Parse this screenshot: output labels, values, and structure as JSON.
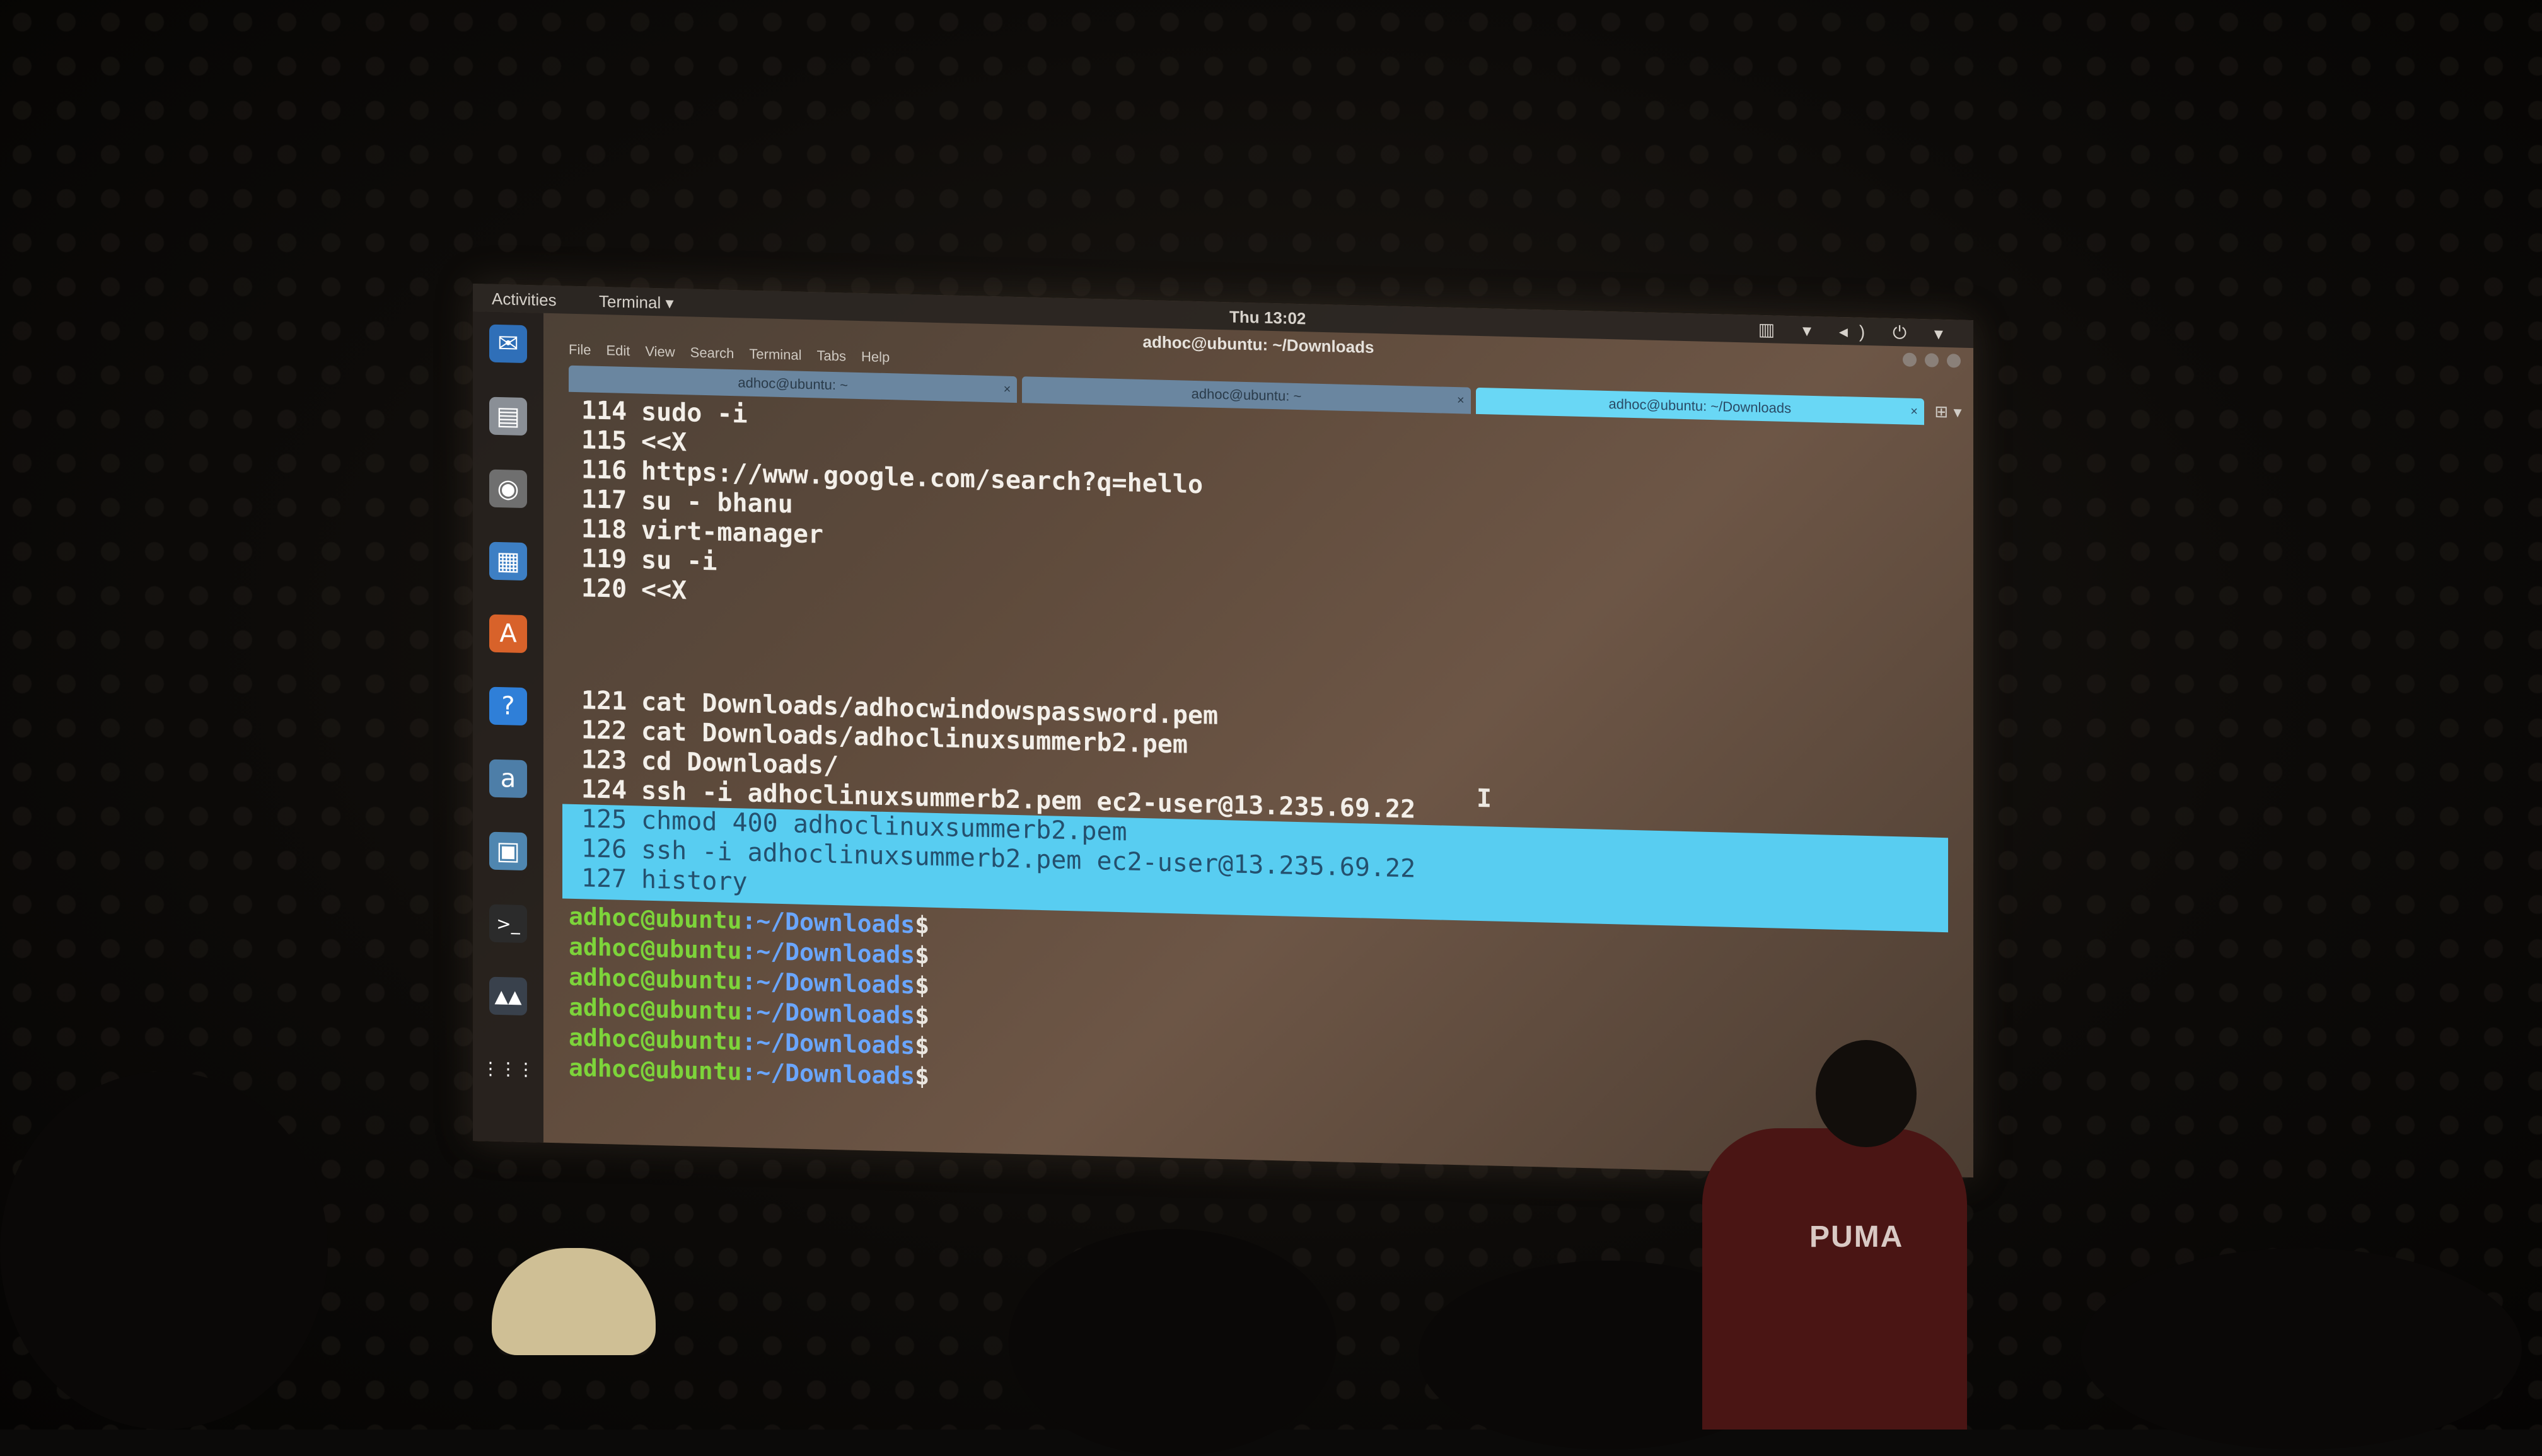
{
  "topbar": {
    "activities": "Activities",
    "app_menu": "Terminal ▾",
    "clock": "Thu 13:02",
    "tray": "▥ ▾ ◂) ⏻ ▾"
  },
  "window": {
    "title": "adhoc@ubuntu: ~/Downloads"
  },
  "menubar": {
    "items": [
      "File",
      "Edit",
      "View",
      "Search",
      "Terminal",
      "Tabs",
      "Help"
    ]
  },
  "tabs": [
    {
      "label": "adhoc@ubuntu: ~",
      "close": "×"
    },
    {
      "label": "adhoc@ubuntu: ~",
      "close": "×"
    },
    {
      "label": "adhoc@ubuntu: ~/Downloads",
      "close": "×"
    }
  ],
  "tab_extra": "⊞ ▾",
  "history": [
    {
      "num": "114",
      "cmd": "sudo -i"
    },
    {
      "num": "115",
      "cmd": "<<X"
    },
    {
      "num": "116",
      "cmd": "https://www.google.com/search?q=hello"
    },
    {
      "num": "117",
      "cmd": "su - bhanu"
    },
    {
      "num": "118",
      "cmd": "virt-manager"
    },
    {
      "num": "119",
      "cmd": "su -i"
    },
    {
      "num": "120",
      "cmd": "<<X"
    },
    {
      "num": "121",
      "cmd": "cat Downloads/adhocwindowspassword.pem"
    },
    {
      "num": "122",
      "cmd": "cat Downloads/adhoclinuxsummerb2.pem"
    },
    {
      "num": "123",
      "cmd": "cd Downloads/"
    },
    {
      "num": "124",
      "cmd": "ssh -i adhoclinuxsummerb2.pem ec2-user@13.235.69.22"
    }
  ],
  "selected_history": [
    {
      "num": "125",
      "cmd": "chmod 400 adhoclinuxsummerb2.pem"
    },
    {
      "num": "126",
      "cmd": "ssh -i adhoclinuxsummerb2.pem ec2-user@13.235.69.22"
    },
    {
      "num": "127",
      "cmd": "history"
    }
  ],
  "prompt": {
    "user": "adhoc@ubuntu",
    "path": ":~/Downloads",
    "end": "$",
    "count": 6
  },
  "dock_icons": [
    {
      "name": "thunderbird-icon",
      "glyph": "✉",
      "color": "#2f6fb8"
    },
    {
      "name": "files-icon",
      "glyph": "▤",
      "color": "#8a8f96"
    },
    {
      "name": "rhythmbox-icon",
      "glyph": "◉",
      "color": "#6f6f6f"
    },
    {
      "name": "libreoffice-writer-icon",
      "glyph": "▦",
      "color": "#3d7fc4"
    },
    {
      "name": "software-center-icon",
      "glyph": "A",
      "color": "#d8622a"
    },
    {
      "name": "help-icon",
      "glyph": "?",
      "color": "#2f7fd8"
    },
    {
      "name": "amazon-icon",
      "glyph": "a",
      "color": "#4d7ea8"
    },
    {
      "name": "screenshot-icon",
      "glyph": "▣",
      "color": "#4f86b0"
    },
    {
      "name": "terminal-icon",
      "glyph": ">_",
      "color": "#2b2b2b"
    },
    {
      "name": "virt-manager-icon",
      "glyph": "▲▲",
      "color": "#39414c"
    },
    {
      "name": "app-grid-icon",
      "glyph": "⋮⋮⋮",
      "color": "transparent"
    }
  ],
  "presenter_shirt_text": "PUMA"
}
